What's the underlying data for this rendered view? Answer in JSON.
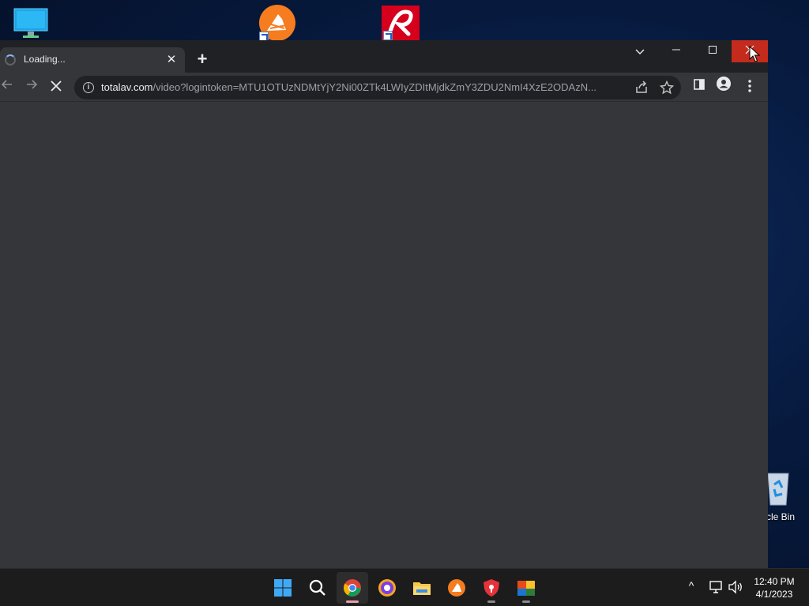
{
  "desktop": {
    "icons": {
      "pc": "monitor-icon",
      "avast": "avast-icon",
      "avira": "avira-icon",
      "recycle_bin": {
        "icon": "recycle-bin-icon",
        "label": "cle Bin"
      }
    }
  },
  "browser": {
    "tab": {
      "title": "Loading...",
      "close_label": "✕"
    },
    "new_tab_label": "+",
    "window_controls": {
      "tab_search": "⌄",
      "minimize": "—",
      "maximize": "☐",
      "close": "✕"
    },
    "address_bar": {
      "host": "totalav.com",
      "path": "/video?logintoken=MTU1OTUzNDMtYjY2Ni00ZTk4LWIyZDItMjdkZmY3ZDU2NmI4XzE2ODAzN..."
    }
  },
  "taskbar": {
    "apps": [
      {
        "name": "start",
        "icon": "windows-start-icon"
      },
      {
        "name": "search",
        "icon": "search-icon"
      },
      {
        "name": "chrome",
        "icon": "chrome-icon",
        "active": true
      },
      {
        "name": "avast-secure-browser",
        "icon": "avast-browser-icon"
      },
      {
        "name": "file-explorer",
        "icon": "folder-icon"
      },
      {
        "name": "avast",
        "icon": "avast-icon"
      },
      {
        "name": "totalav",
        "icon": "shield-icon"
      },
      {
        "name": "avg",
        "icon": "avg-icon"
      }
    ],
    "tray": {
      "chevron": "^",
      "time": "12:40 PM",
      "date": "4/1/2023"
    }
  },
  "colors": {
    "accent_close": "#c42b1c",
    "titlebar": "#202124",
    "toolbar": "#35363a",
    "avast_orange": "#f57c1f",
    "avira_red": "#d6001c"
  }
}
